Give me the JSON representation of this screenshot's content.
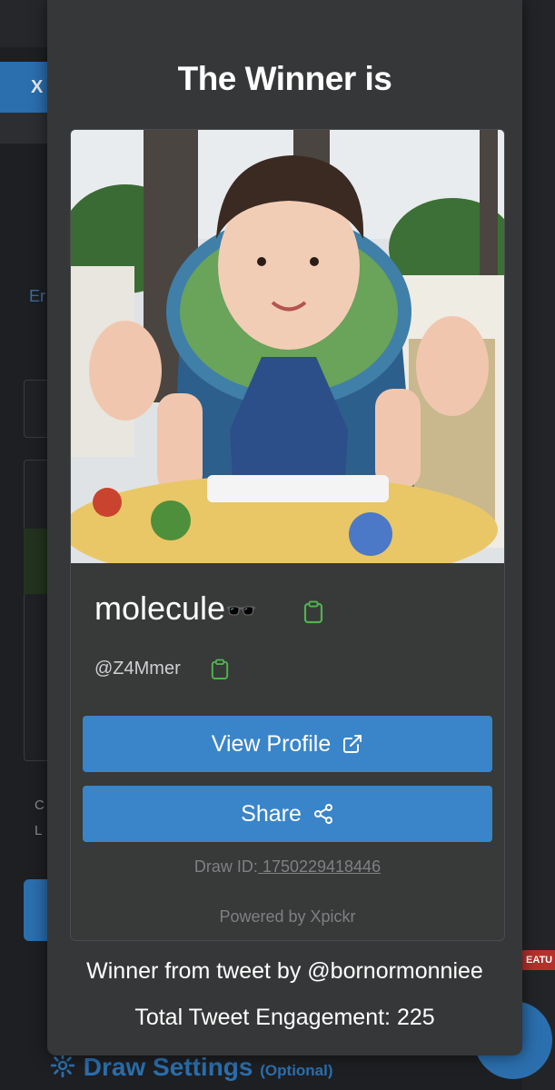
{
  "modal": {
    "title": "The Winner is",
    "winner": {
      "display_name": "molecule",
      "name_emoji": "🕶️",
      "handle": "@Z4Mmer",
      "avatar": "winner-profile-photo"
    },
    "buttons": {
      "view_profile": "View Profile",
      "share": "Share"
    },
    "draw_id_label": "Draw ID:",
    "draw_id_value": " 1750229418446",
    "powered_by": "Powered by Xpickr",
    "tweet_source": "Winner from tweet by @bornormonniee",
    "engagement": "Total Tweet Engagement: 225"
  },
  "background": {
    "tab_label": "X",
    "left_text_1": "Er",
    "left_text_2": "C",
    "left_text_3": "L",
    "section_title": "Draw Settings",
    "section_optional": "(Optional)",
    "badge_text": "EATU"
  },
  "colors": {
    "accent": "#3a85c9",
    "modal_bg": "#363738",
    "clipboard_green": "#4fb24f"
  }
}
